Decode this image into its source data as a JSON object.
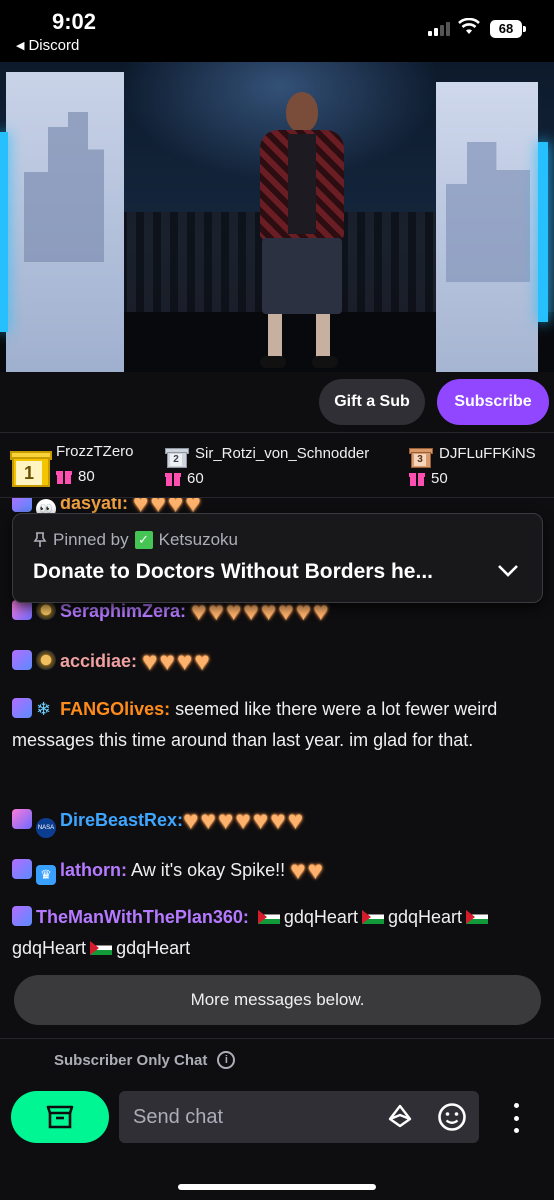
{
  "status_bar": {
    "time": "9:02",
    "back_app": "Discord",
    "battery": "68"
  },
  "actions": {
    "gift_label": "Gift a Sub",
    "subscribe_label": "Subscribe"
  },
  "leaderboard": {
    "gifters": [
      {
        "rank": "1",
        "name": "FrozzTZero",
        "count": "80"
      },
      {
        "rank": "2",
        "name": "Sir_Rotzi_von_Schnodder",
        "count": "60"
      },
      {
        "rank": "3",
        "name": "DJFLuFFKiNS",
        "count": "50"
      }
    ]
  },
  "pinned": {
    "by_label": "Pinned by",
    "by_user": "Ketsuzoku",
    "message": "Donate to Doctors Without Borders he..."
  },
  "chat": {
    "partial_user": "dasyati:",
    "messages": [
      {
        "user": "SeraphimZera:",
        "color": "#b57aff",
        "text": "",
        "hearts": 8
      },
      {
        "user": "accidiae:",
        "color": "#f0a0a0",
        "text": "",
        "hearts": 4
      },
      {
        "user": "FANGOlives:",
        "color": "#ff8c1a",
        "text": "seemed like there were a lot fewer weird messages this time around than last year. im glad for that."
      },
      {
        "user": "DireBeastRex:",
        "color": "#3ea6ff",
        "text": "",
        "hearts": 7
      },
      {
        "user": "lathorn:",
        "color": "#b57aff",
        "text": "Aw it's okay Spike!!",
        "hearts": 2
      },
      {
        "user": "TheManWithThePlan360:",
        "color": "#b57aff",
        "emote_word": "gdqHeart"
      }
    ]
  },
  "more_messages": "More messages below.",
  "footer": {
    "subscriber_only": "Subscriber Only Chat",
    "input_placeholder": "Send chat"
  },
  "colors": {
    "accent": "#9147ff",
    "store_button": "#00f593",
    "background": "#0e0e10"
  },
  "icons": [
    "back-triangle-icon",
    "signal-icon",
    "wifi-icon",
    "battery-icon",
    "gift-icon",
    "pin-icon",
    "chevron-down-icon",
    "info-icon",
    "store-icon",
    "bits-icon",
    "emote-icon",
    "more-vertical-icon"
  ]
}
